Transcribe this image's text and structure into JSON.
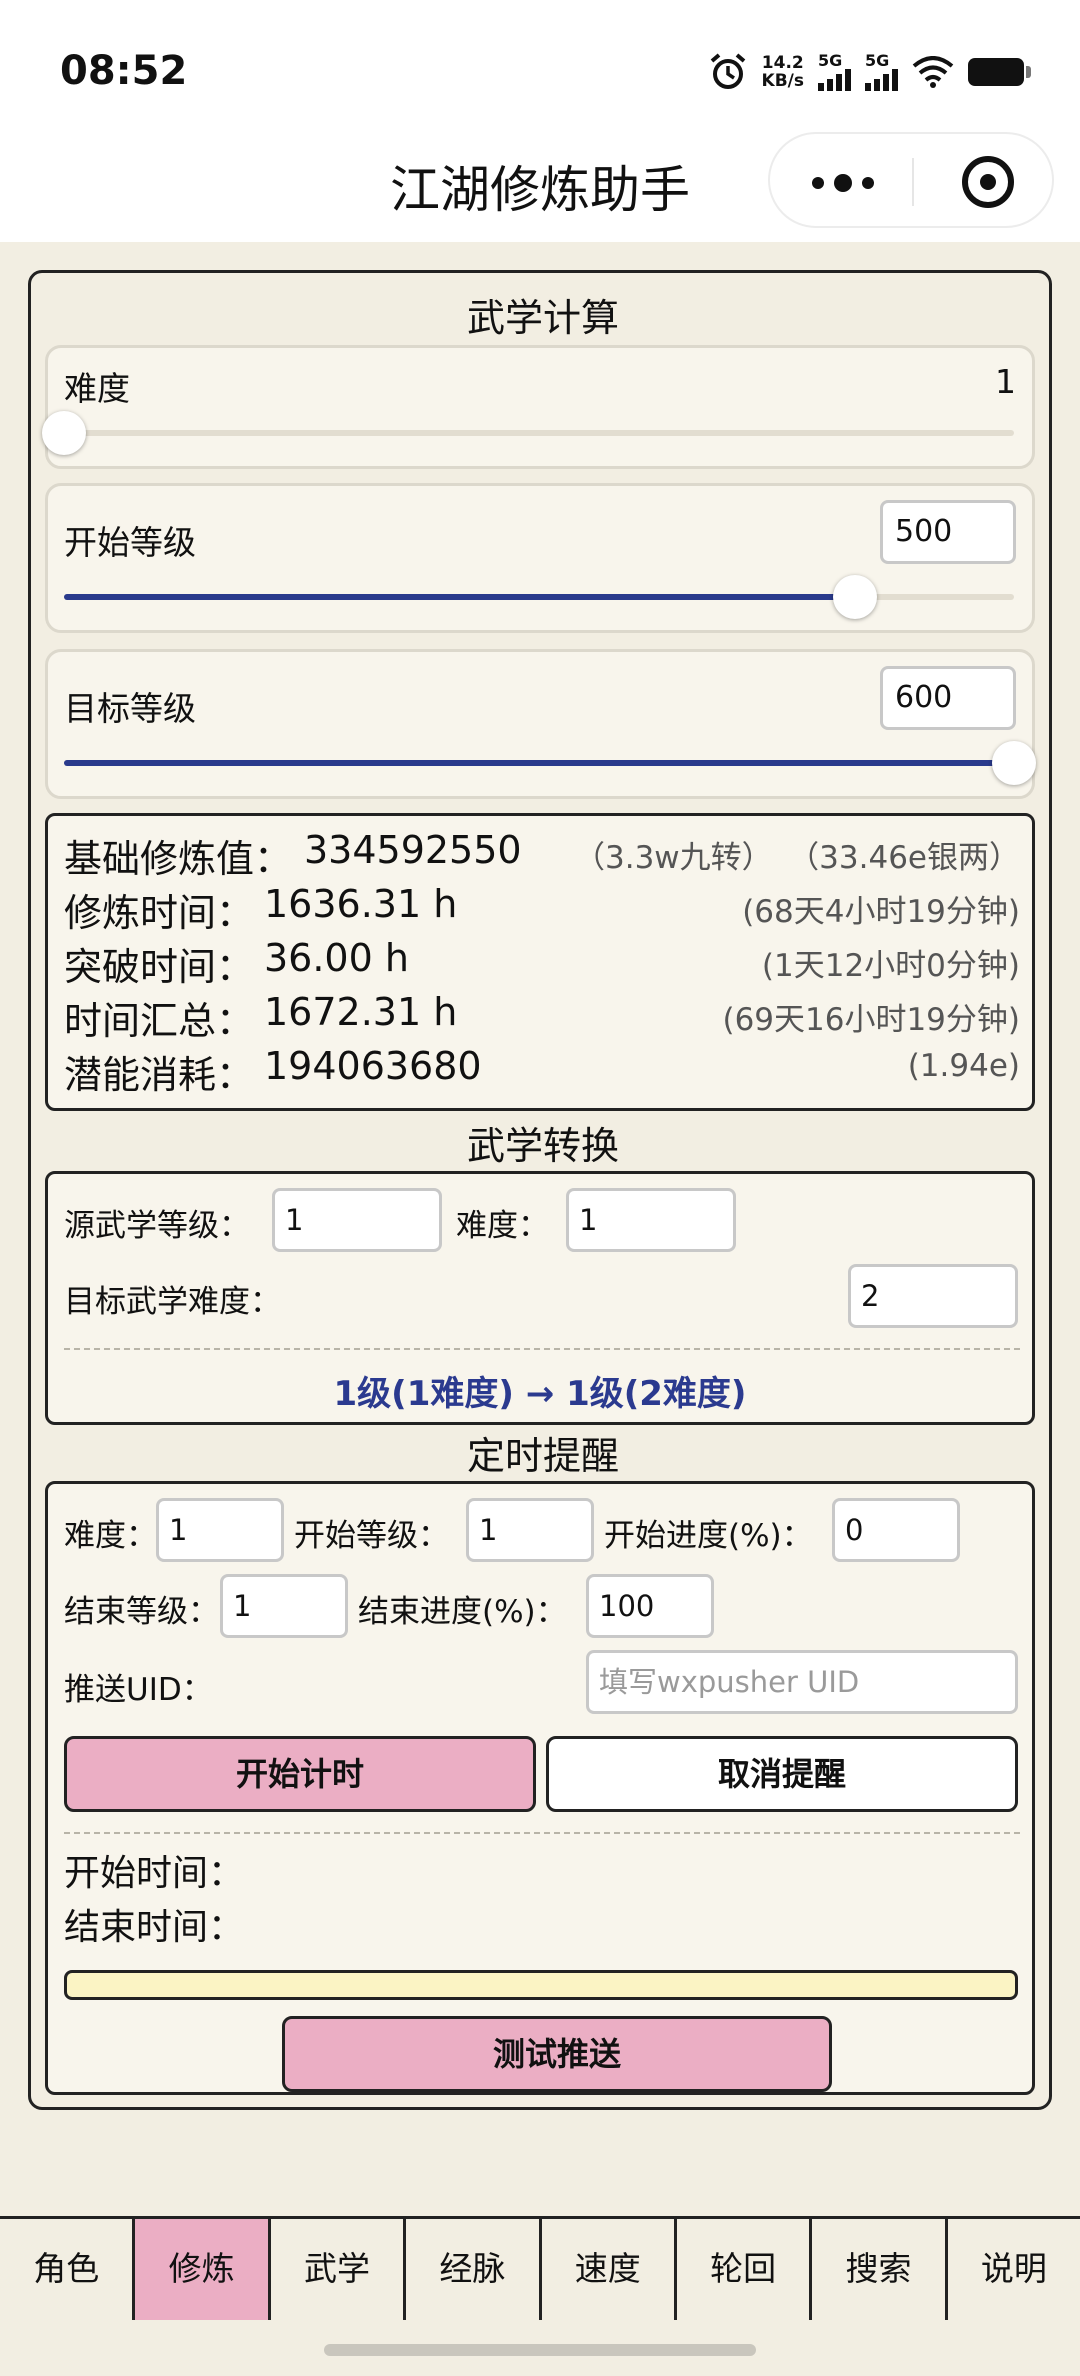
{
  "status_bar": {
    "time": "08:52",
    "net_speed_value": "14.2",
    "net_speed_unit": "KB/s",
    "signal1_label": "5G",
    "signal2_label": "5G",
    "icons": [
      "alarm-icon",
      "signal-icon",
      "signal-icon",
      "wifi-icon",
      "battery-icon"
    ]
  },
  "nav": {
    "title": "江湖修炼助手",
    "icons": [
      "more-icon",
      "target-icon"
    ]
  },
  "martial_calc": {
    "title": "武学计算",
    "difficulty": {
      "label": "难度",
      "value": "1",
      "slider_fraction": 0.0
    },
    "start_level": {
      "label": "开始等级",
      "value": "500",
      "slider_fraction": 0.833
    },
    "target_level": {
      "label": "目标等级",
      "value": "600",
      "slider_fraction": 1.0
    },
    "results": {
      "base": {
        "label": "基础修炼值：",
        "value": "334592550",
        "note1": "（3.3w九转）",
        "note2": "（33.46e银两）"
      },
      "train_time": {
        "label": "修炼时间：",
        "value": "1636.31 h",
        "note": "(68天4小时19分钟)"
      },
      "break_time": {
        "label": "突破时间：",
        "value": "36.00 h",
        "note": "(1天12小时0分钟)"
      },
      "total_time": {
        "label": "时间汇总：",
        "value": "1672.31 h",
        "note": "(69天16小时19分钟)"
      },
      "potential": {
        "label": "潜能消耗：",
        "value": "194063680",
        "note": "(1.94e)"
      }
    }
  },
  "martial_convert": {
    "title": "武学转换",
    "source_level_label": "源武学等级：",
    "source_level_value": "1",
    "difficulty_label": "难度：",
    "difficulty_value": "1",
    "target_difficulty_label": "目标武学难度：",
    "target_difficulty_value": "2",
    "result": "1级(1难度) → 1级(2难度)"
  },
  "timer": {
    "title": "定时提醒",
    "difficulty_label": "难度：",
    "difficulty_value": "1",
    "start_level_label": "开始等级：",
    "start_level_value": "1",
    "start_progress_label": "开始进度(%)：",
    "start_progress_value": "0",
    "end_level_label": "结束等级：",
    "end_level_value": "1",
    "end_progress_label": "结束进度(%)：",
    "end_progress_value": "100",
    "uid_label": "推送UID：",
    "uid_placeholder": "填写wxpusher UID",
    "start_button": "开始计时",
    "cancel_button": "取消提醒",
    "start_time_label": "开始时间：",
    "end_time_label": "结束时间：",
    "progress_fraction": 0.0,
    "test_button": "测试推送"
  },
  "tabs": [
    "角色",
    "修炼",
    "武学",
    "经脉",
    "速度",
    "轮回",
    "搜索",
    "说明"
  ],
  "active_tab_index": 1,
  "colors": {
    "background": "#f2eee2",
    "accent_pink": "#ebaec4",
    "slider_fill": "#2a3a8c",
    "result_blue": "#2b3a8f"
  }
}
